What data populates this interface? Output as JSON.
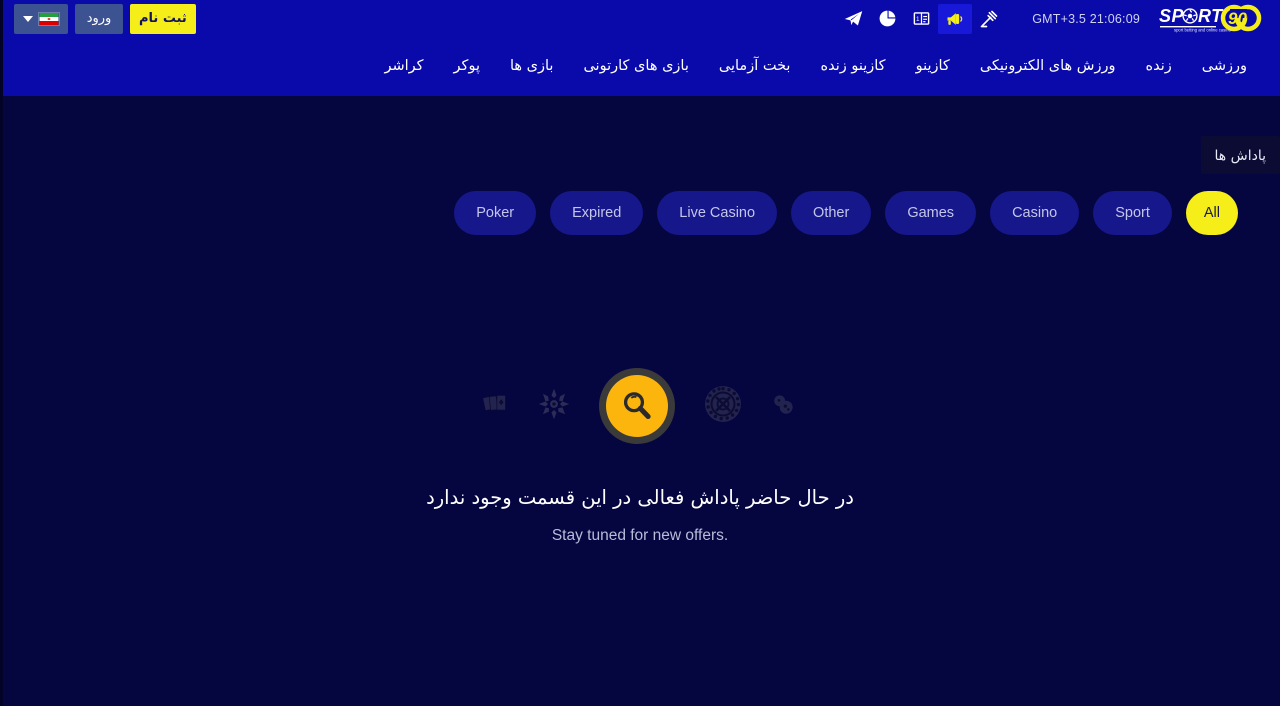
{
  "topbar": {
    "language": {
      "icon": "chevron-down-icon",
      "flag": "iran-flag-icon",
      "label": ""
    },
    "login_label": "ورود",
    "register_label": "ثبت نام",
    "icons": [
      {
        "name": "telegram-icon",
        "active": false
      },
      {
        "name": "pie-chart-icon",
        "active": false
      },
      {
        "name": "results-scoreboard-icon",
        "active": false
      },
      {
        "name": "megaphone-icon",
        "active": true
      },
      {
        "name": "gavel-icon",
        "active": false
      }
    ],
    "clock": "GMT+3.5  21:06:09",
    "logo": {
      "text": "SPORT",
      "suffix": "90",
      "tagline": "sport betting and online casino"
    }
  },
  "nav": {
    "items": [
      {
        "label": "ورزشی"
      },
      {
        "label": "زنده"
      },
      {
        "label": "ورزش های الکترونیکی"
      },
      {
        "label": "کازینو"
      },
      {
        "label": "کازینو زنده"
      },
      {
        "label": "بخت آزمایی"
      },
      {
        "label": "بازی های کارتونی"
      },
      {
        "label": "بازی ها"
      },
      {
        "label": "پوکر"
      },
      {
        "label": "کراشر"
      }
    ]
  },
  "page": {
    "title": "پاداش ها",
    "filters": [
      {
        "label": "All",
        "active": true
      },
      {
        "label": "Sport",
        "active": false
      },
      {
        "label": "Casino",
        "active": false
      },
      {
        "label": "Games",
        "active": false
      },
      {
        "label": "Other",
        "active": false
      },
      {
        "label": "Live Casino",
        "active": false
      },
      {
        "label": "Expired",
        "active": false
      },
      {
        "label": "Poker",
        "active": false
      }
    ],
    "empty_state": {
      "icons": [
        "dice-icon",
        "poker-chip-icon",
        "magnifier-icon",
        "roulette-wheel-icon",
        "playing-cards-icon"
      ],
      "title": "در حال حاضر پاداش فعالی در این قسمت وجود ندارد",
      "subtitle": ".Stay tuned for new offers"
    }
  },
  "colors": {
    "brand_blue": "#0a0aaa",
    "page_bg": "#050540",
    "accent_yellow": "#f5ee18",
    "pill_bg": "#17178c",
    "magnifier_amber": "#fbb50d"
  }
}
